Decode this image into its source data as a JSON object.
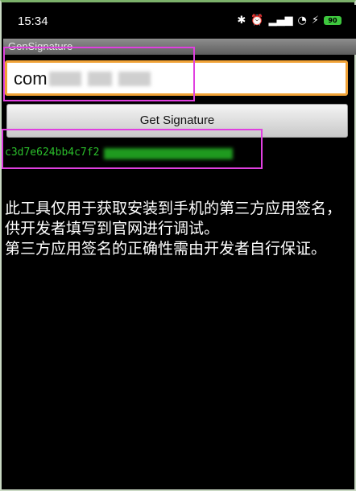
{
  "status_bar": {
    "time": "15:34",
    "icons": [
      "bluetooth-icon",
      "alarm-icon",
      "signal-icon",
      "wifi-icon",
      "charging-icon"
    ],
    "battery": "90"
  },
  "app": {
    "title": "GenSignature"
  },
  "package_input": {
    "value": "com",
    "note_obscured": true
  },
  "get_signature_button": {
    "label": "Get Signature"
  },
  "signature_result": {
    "text": "c3d7e624bb4c7f2",
    "color": "#2bbf2b"
  },
  "description": {
    "line1": "此工具仅用于获取安装到手机的第三方应用签名，供开发者填写到官网进行调试。",
    "line2": "第三方应用签名的正确性需由开发者自行保证。"
  },
  "colors": {
    "highlight": "#e040e0",
    "input_focus": "#f0a237",
    "background": "#000000"
  }
}
